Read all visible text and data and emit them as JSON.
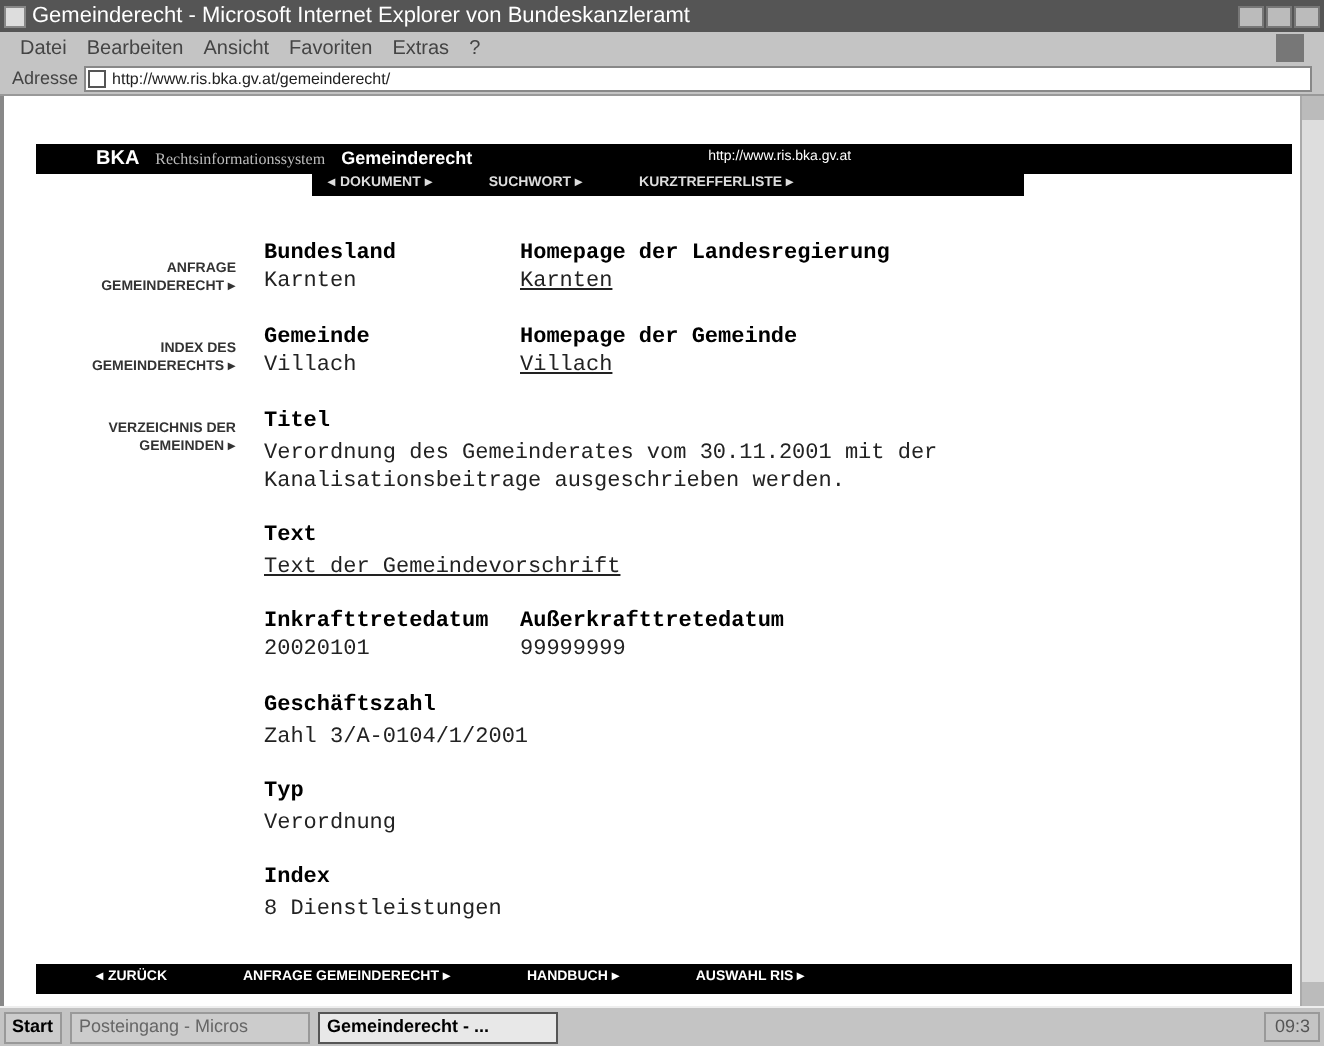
{
  "window": {
    "title": "Gemeinderecht - Microsoft Internet Explorer von Bundeskanzleramt"
  },
  "menu": [
    "Datei",
    "Bearbeiten",
    "Ansicht",
    "Favoriten",
    "Extras",
    "?"
  ],
  "address": {
    "label": "Adresse",
    "value": "http://www.ris.bka.gv.at/gemeinderecht/"
  },
  "header": {
    "logo": "BKA",
    "system": "Rechtsinformationssystem",
    "section": "Gemeinderecht",
    "url": "http://www.ris.bka.gv.at"
  },
  "nav": [
    "◂ DOKUMENT ▸",
    "SUCHWORT ▸",
    "KURZTREFFERLISTE ▸"
  ],
  "sidebar": [
    "ANFRAGE GEMEINDERECHT ▸",
    "INDEX DES GEMEINDERECHTS ▸",
    "VERZEICHNIS DER GEMEINDEN ▸"
  ],
  "content": [
    {
      "kind": "pair",
      "items": [
        {
          "label": "Bundesland",
          "value": "Karnten",
          "link": false
        },
        {
          "label": "Homepage der Landesregierung",
          "value": "Karnten",
          "link": true
        }
      ]
    },
    {
      "kind": "pair",
      "items": [
        {
          "label": "Gemeinde",
          "value": "Villach",
          "link": false
        },
        {
          "label": "Homepage der Gemeinde",
          "value": "Villach",
          "link": true
        }
      ]
    },
    {
      "kind": "single",
      "label": "Titel",
      "value": "Verordnung des Gemeinderates vom 30.11.2001 mit der Kanalisationsbeitrage ausgeschrieben werden.",
      "link": false
    },
    {
      "kind": "single",
      "label": "Text",
      "value": "Text der Gemeindevorschrift",
      "link": true
    },
    {
      "kind": "pair",
      "items": [
        {
          "label": "Inkrafttretedatum",
          "value": "20020101",
          "link": false
        },
        {
          "label": "Außerkrafttretedatum",
          "value": "99999999",
          "link": false
        }
      ]
    },
    {
      "kind": "single",
      "label": "Geschäftszahl",
      "value": "Zahl 3/A-0104/1/2001",
      "link": false
    },
    {
      "kind": "single",
      "label": "Typ",
      "value": "Verordnung",
      "link": false
    },
    {
      "kind": "single",
      "label": "Index",
      "value": "8 Dienstleistungen",
      "link": false
    }
  ],
  "footer": [
    "◂ ZURÜCK",
    "ANFRAGE GEMEINDERECHT ▸",
    "HANDBUCH ▸",
    "AUSWAHL RIS ▸"
  ],
  "taskbar": {
    "start": "Start",
    "tasks": [
      {
        "label": "Posteingang - Micros",
        "selected": false
      },
      {
        "label": "Gemeinderecht - ...",
        "selected": true
      }
    ],
    "clock": "09:3"
  }
}
